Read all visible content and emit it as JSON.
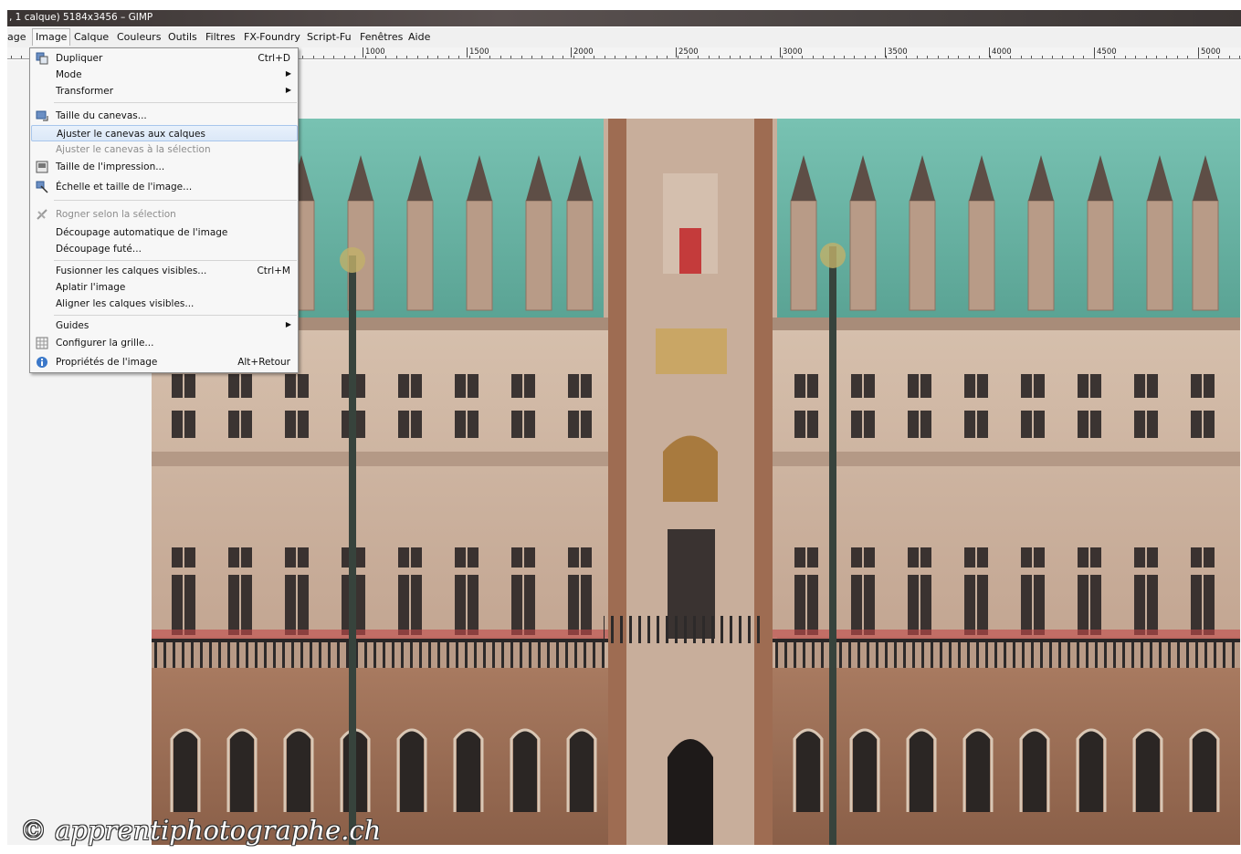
{
  "window": {
    "title": ", 1 calque) 5184x3456 – GIMP"
  },
  "menubar": {
    "items": [
      {
        "label": "age"
      },
      {
        "label": "Image"
      },
      {
        "label": "Calque"
      },
      {
        "label": "Couleurs"
      },
      {
        "label": "Outils"
      },
      {
        "label": "Filtres"
      },
      {
        "label": "FX-Foundry"
      },
      {
        "label": "Script-Fu"
      },
      {
        "label": "Fenêtres"
      },
      {
        "label": "Aide"
      }
    ]
  },
  "ruler": {
    "labels": [
      "1000",
      "1500",
      "2000",
      "2500",
      "3000",
      "3500",
      "4000",
      "4500",
      "5000"
    ]
  },
  "image_menu": {
    "items": [
      {
        "label": "Dupliquer",
        "shortcut": "Ctrl+D",
        "icon": "duplicate-icon"
      },
      {
        "label": "Mode",
        "submenu": true
      },
      {
        "label": "Transformer",
        "submenu": true
      },
      {
        "label": "Taille du canevas...",
        "icon": "canvas-size-icon"
      },
      {
        "label": "Ajuster le canevas aux calques",
        "highlighted": true
      },
      {
        "label": "Ajuster le canevas à la sélection",
        "disabled": true
      },
      {
        "label": "Taille de l'impression...",
        "icon": "print-size-icon"
      },
      {
        "label": "Échelle et taille de l'image...",
        "icon": "scale-image-icon"
      },
      {
        "label": "Rogner selon la sélection",
        "disabled": true,
        "icon": "crop-icon"
      },
      {
        "label": "Découpage automatique de l'image"
      },
      {
        "label": "Découpage futé..."
      },
      {
        "label": "Fusionner les calques visibles...",
        "shortcut": "Ctrl+M"
      },
      {
        "label": "Aplatir l'image"
      },
      {
        "label": "Aligner les calques visibles..."
      },
      {
        "label": "Guides",
        "submenu": true
      },
      {
        "label": "Configurer la grille...",
        "icon": "grid-icon"
      },
      {
        "label": "Propriétés de l'image",
        "shortcut": "Alt+Retour",
        "icon": "info-icon"
      }
    ]
  },
  "watermark": "© apprentiphotographe.ch",
  "colors": {
    "roof": "#6fb8a8",
    "facade": "#c9ad9a",
    "brick": "#9e6f55",
    "menu_highlight": "#dbe8f8"
  }
}
